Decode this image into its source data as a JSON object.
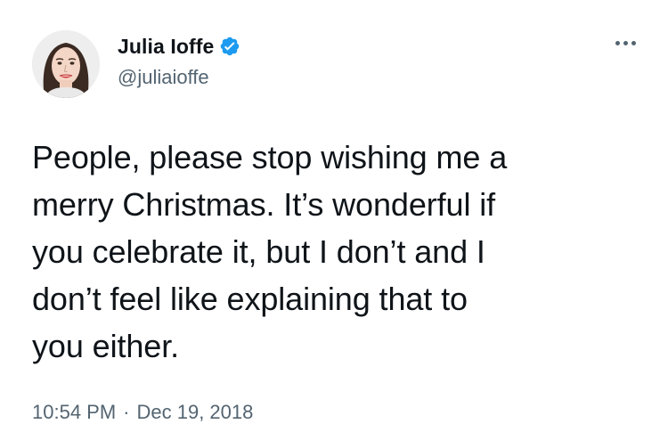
{
  "author": {
    "display_name": "Julia Ioffe",
    "handle": "@juliaioffe",
    "verified": true
  },
  "tweet": {
    "lines": [
      "People, please stop wishing me a",
      "merry Christmas. It’s wonderful if",
      "you celebrate it, but I don’t and I",
      "don’t feel like explaining that to",
      "you either."
    ]
  },
  "meta": {
    "time": "10:54 PM",
    "separator": "·",
    "date": "Dec 19, 2018"
  },
  "icons": {
    "verified": "verified-badge-icon",
    "more": "more-options-icon"
  },
  "colors": {
    "text_primary": "#0f1419",
    "text_secondary": "#536471",
    "verified_blue": "#1d9bf0",
    "background": "#ffffff"
  }
}
